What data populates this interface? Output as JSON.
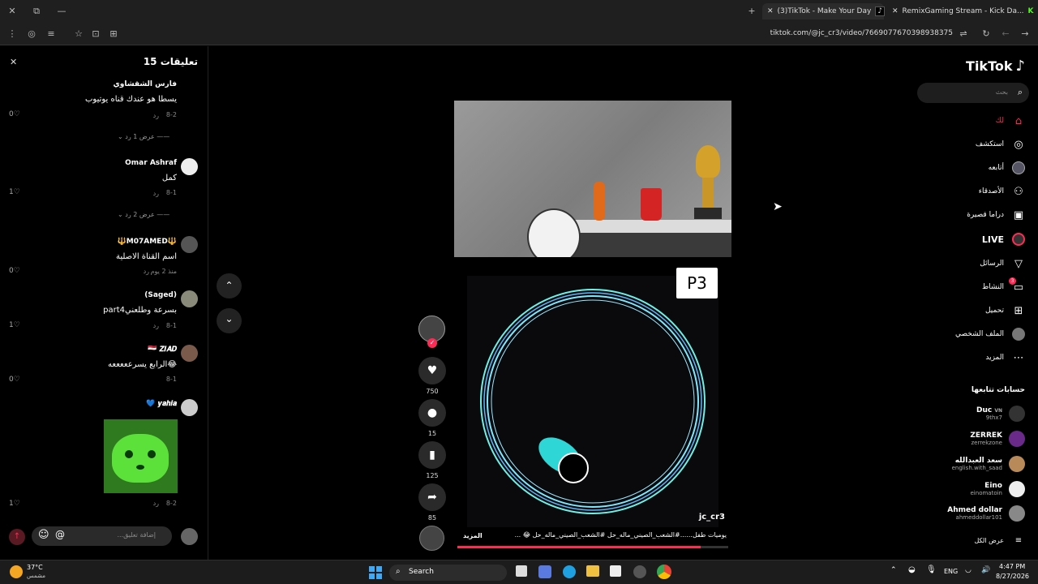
{
  "browser": {
    "tabs": [
      {
        "title": "(3)TikTok - Make Your Day"
      },
      {
        "title": "RemixGaming Stream - Kick Da..."
      }
    ],
    "url": "tiktok.com/@jc_cr3/video/7669077670398938375"
  },
  "comments": {
    "title": "تعليقات 15",
    "items": [
      {
        "name": "فارس الشقشاوي",
        "text": "يسطا هو عندك قناه يوتيوب",
        "date": "8-2",
        "reply": "رد",
        "likes": "0",
        "replies": "عرض 1 رد"
      },
      {
        "name": "Omar Ashraf",
        "text": "كمل",
        "date": "8-1",
        "reply": "رد",
        "likes": "1",
        "replies": "عرض 2 رد"
      },
      {
        "name": "🔱M07AMED🔱",
        "text": "اسم القناة الاصلية",
        "date": "منذ 2 يوم",
        "reply": "رد",
        "likes": "0"
      },
      {
        "name": "(Saged)",
        "text": "part4بسرعة وطلعني",
        "date": "8-1",
        "reply": "رد",
        "likes": "1"
      },
      {
        "name": "🇪🇬 𝒁𝑰𝑨𝑫",
        "text": "الرابع يسرعععععه😂",
        "date": "8-1",
        "reply": "رد",
        "likes": "0"
      },
      {
        "name": "💙 𝒚𝒂𝒉𝒊𝒂",
        "text": "",
        "date": "8-2",
        "reply": "رد",
        "likes": "1"
      }
    ],
    "input_placeholder": "إضافة تعليق...",
    "at_symbol": "@"
  },
  "video": {
    "badge": "P3",
    "author": "jc_cr3",
    "caption": "يوميات طفل......#الشعب_الصيني_ماله_حل #الشعب_الصيني_ماله_حل 😂 ...",
    "more": "المزيد",
    "likes": "750",
    "comments": "15",
    "saves": "125",
    "shares": "85"
  },
  "sidebar": {
    "logo": "TikTok",
    "search_placeholder": "بحث",
    "nav": [
      {
        "label": "لك",
        "icon": "home-icon",
        "active": true
      },
      {
        "label": "استكشف",
        "icon": "compass-icon"
      },
      {
        "label": "أتابعه",
        "icon": "following-icon"
      },
      {
        "label": "الأصدقاء",
        "icon": "friends-icon"
      },
      {
        "label": "دراما قصيرة",
        "icon": "drama-icon"
      },
      {
        "label": "LIVE",
        "icon": "live-icon"
      },
      {
        "label": "الرسائل",
        "icon": "messages-icon"
      },
      {
        "label": "النشاط",
        "icon": "activity-icon",
        "badge": "3"
      },
      {
        "label": "تحميل",
        "icon": "upload-icon"
      },
      {
        "label": "الملف الشخصي",
        "icon": "profile-icon"
      },
      {
        "label": "المزيد",
        "icon": "more-icon"
      }
    ],
    "following_title": "حسابات تتابعها",
    "following": [
      {
        "name": "Duc",
        "tag": "VN",
        "handle": "9thx7"
      },
      {
        "name": "ZERREK",
        "handle": "zerrekzone"
      },
      {
        "name": "سعد العبدالله",
        "handle": "english.with_saad"
      },
      {
        "name": "Eino",
        "handle": "einomatoin"
      },
      {
        "name": "Ahmed dollar",
        "handle": "ahmeddollar101"
      }
    ],
    "see_all": "عرض الكل"
  },
  "taskbar": {
    "temp": "37°C",
    "weather": "مشمس",
    "search": "Search",
    "lang": "ENG",
    "time": "4:47 PM",
    "date": "8/27/2026"
  },
  "colors": {
    "accent": "#fe2c55",
    "ring": "#7fe8ff",
    "bg": "#000000"
  }
}
